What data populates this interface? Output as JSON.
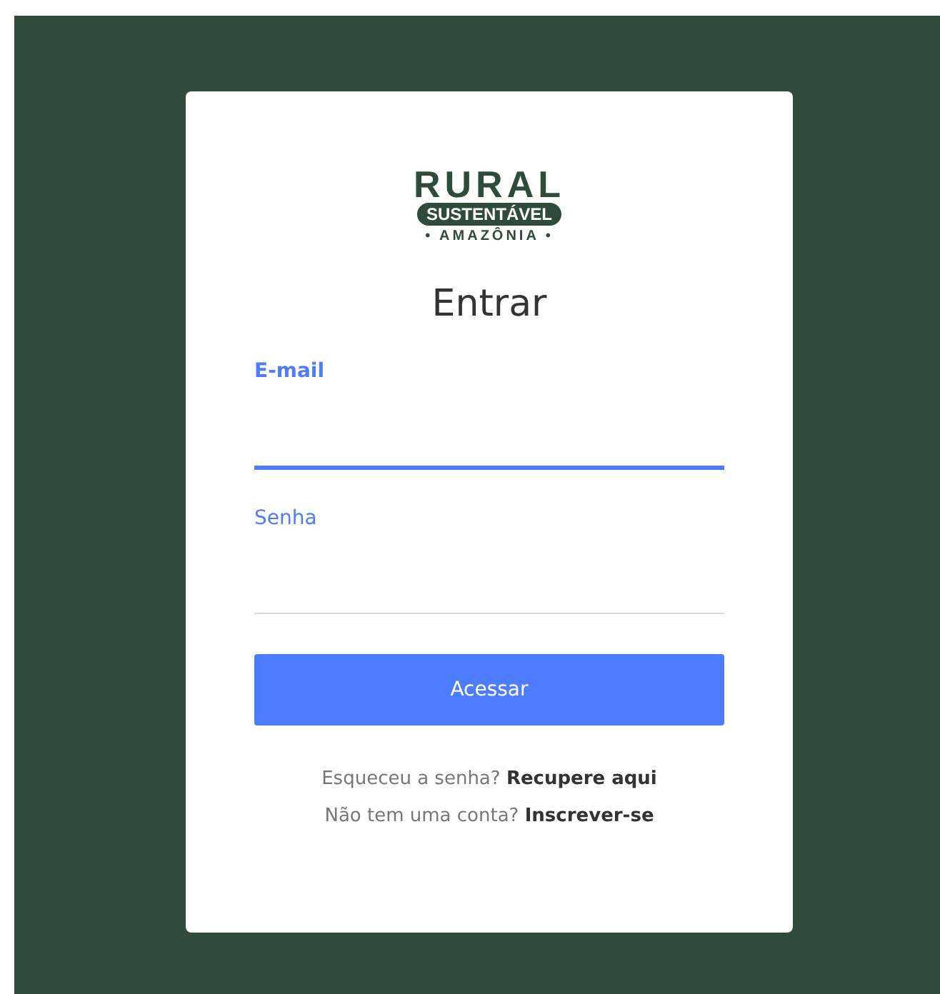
{
  "logo": {
    "title": "RURAL",
    "badge": "SUSTENTÁVEL",
    "subtitle": "• AMAZÔNIA •"
  },
  "heading": "Entrar",
  "fields": [
    {
      "label": "E-mail",
      "focused": true
    },
    {
      "label": "Senha",
      "focused": false
    }
  ],
  "submit": "Acessar",
  "links": [
    {
      "prompt": "Esqueceu a senha?",
      "link": "Recupere aqui"
    },
    {
      "prompt": "Não tem uma conta?",
      "link": "Inscrever-se"
    }
  ]
}
